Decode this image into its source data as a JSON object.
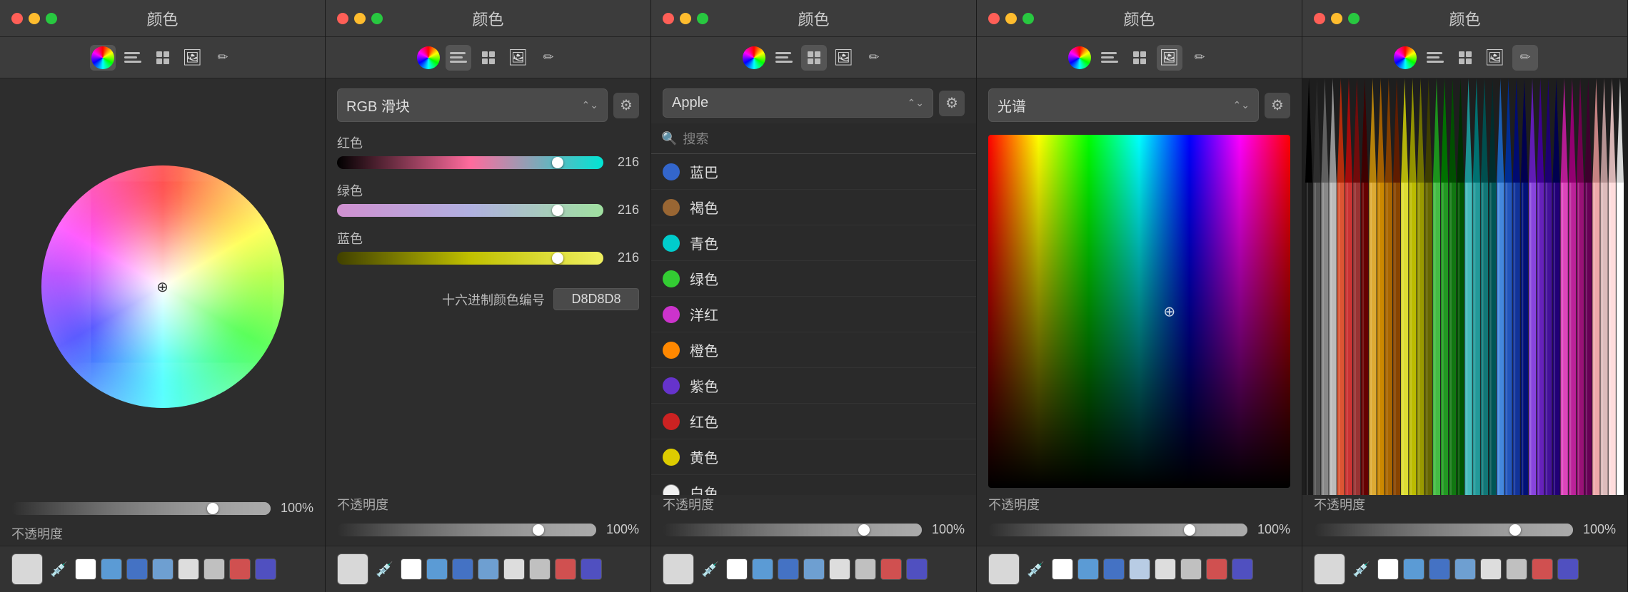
{
  "panels": [
    {
      "id": "wheel",
      "title": "颜色",
      "mode": "color-wheel",
      "opacity_label": "不透明度",
      "opacity_value": "100%",
      "swatches": [
        "#d8d8d8",
        "#ffffff",
        "#5b9bd5",
        "#4472c4",
        "#6e9fd1",
        "#ffffff",
        "#c0c0c0",
        "#d05050",
        "#5050c0"
      ]
    },
    {
      "id": "rgb",
      "title": "颜色",
      "mode": "rgb-sliders",
      "mode_label": "RGB 滑块",
      "sliders": [
        {
          "label": "红色",
          "value": "216",
          "pct": 0.85
        },
        {
          "label": "绿色",
          "value": "216",
          "pct": 0.85
        },
        {
          "label": "蓝色",
          "value": "216",
          "pct": 0.85
        }
      ],
      "hex_label": "十六进制颜色编号",
      "hex_value": "D8D8D8",
      "opacity_label": "不透明度",
      "opacity_value": "100%",
      "swatches": [
        "#d8d8d8",
        "#ffffff",
        "#5b9bd5",
        "#4472c4",
        "#6e9fd1",
        "#ffffff",
        "#c0c0c0",
        "#d05050",
        "#5050c0"
      ]
    },
    {
      "id": "apple",
      "title": "颜色",
      "mode": "apple-colors",
      "mode_label": "Apple",
      "search_placeholder": "搜索",
      "colors": [
        {
          "name": "蓝巴",
          "color": "#3366cc"
        },
        {
          "name": "褐色",
          "color": "#996633"
        },
        {
          "name": "青色",
          "color": "#00cccc"
        },
        {
          "name": "绿色",
          "color": "#33cc33"
        },
        {
          "name": "洋红",
          "color": "#cc33cc"
        },
        {
          "name": "橙色",
          "color": "#ff8800"
        },
        {
          "name": "紫色",
          "color": "#6633cc"
        },
        {
          "name": "红色",
          "color": "#cc2222"
        },
        {
          "name": "黄色",
          "color": "#ddcc00"
        },
        {
          "name": "白色",
          "color": "#ffffff"
        }
      ],
      "opacity_label": "不透明度",
      "opacity_value": "100%",
      "swatches": [
        "#d8d8d8",
        "#ffffff",
        "#5b9bd5",
        "#4472c4",
        "#6e9fd1",
        "#ffffff",
        "#c0c0c0",
        "#d05050",
        "#5050c0"
      ]
    },
    {
      "id": "spectrum",
      "title": "颜色",
      "mode": "spectrum",
      "mode_label": "光谱",
      "opacity_label": "不透明度",
      "opacity_value": "100%",
      "swatches": [
        "#d8d8d8",
        "#ffffff",
        "#5b9bd5",
        "#4472c4",
        "#b8cce4",
        "#ffffff",
        "#c0c0c0",
        "#d05050",
        "#5050c0"
      ]
    },
    {
      "id": "crayons",
      "title": "颜色",
      "mode": "crayons",
      "opacity_label": "不透明度",
      "opacity_value": "100%",
      "swatches": [
        "#d8d8d8",
        "#ffffff",
        "#5b9bd5",
        "#4472c4",
        "#6e9fd1",
        "#ffffff",
        "#c0c0c0",
        "#d05050",
        "#5050c0"
      ],
      "crayon_colors": [
        "#1a1a1a",
        "#555555",
        "#888888",
        "#bbbbbb",
        "#dd5533",
        "#cc3333",
        "#993333",
        "#660000",
        "#ddaa33",
        "#cc8800",
        "#aa6600",
        "#884400",
        "#dddd33",
        "#bbbb00",
        "#999900",
        "#666600",
        "#44bb44",
        "#229922",
        "#117711",
        "#005500",
        "#44bbbb",
        "#229999",
        "#117777",
        "#005555",
        "#4488dd",
        "#2255bb",
        "#113399",
        "#001177",
        "#8844dd",
        "#6622bb",
        "#441199",
        "#220077",
        "#dd44bb",
        "#bb2299",
        "#991177",
        "#660055",
        "#eeaaaa",
        "#ddbbbb",
        "#ffdddd",
        "#ffffff"
      ]
    }
  ],
  "toolbar_icons": [
    "wheel",
    "sliders",
    "grid",
    "image",
    "crayons"
  ],
  "labels": {
    "close": "●",
    "minimize": "●",
    "maximize": "●"
  }
}
